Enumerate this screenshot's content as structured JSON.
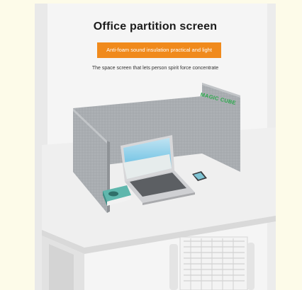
{
  "title": "Office partition screen",
  "badge": "Anti-foam sound insulation practical and light",
  "subtitle": "The space screen that lets person spirit force concentrate",
  "brand": "MAGIC CUBE",
  "colors": {
    "badge": "#f08a1c",
    "felt": "#a8acb0",
    "desk": "#ededed",
    "brand": "#2aa84a"
  }
}
